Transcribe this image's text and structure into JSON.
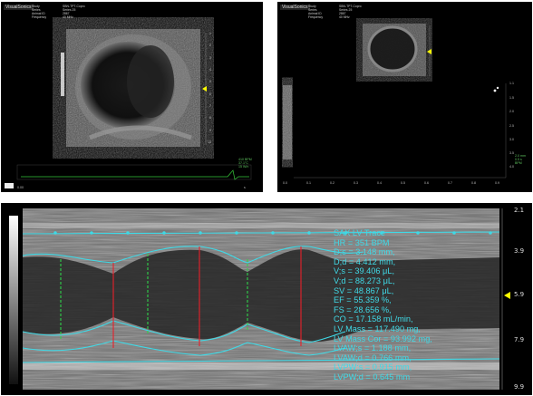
{
  "panel_a": {
    "logo": "VisualSonics",
    "info_labels": [
      "Study",
      "Series",
      "Animal ID",
      "Frequency"
    ],
    "info_values": [
      "SBN-TPT-Copro",
      "Series 25",
      "2867",
      "40 MHz"
    ],
    "depth_ticks": [
      "1",
      "2",
      "3",
      "4",
      "5",
      "6",
      "7",
      "8",
      "9",
      "10"
    ],
    "time_ticks": [
      "0.00",
      "s"
    ],
    "hud": [
      "410 BPM",
      "37.1°C",
      "15 W/n"
    ]
  },
  "panel_b": {
    "logo": "VisualSonics",
    "info_labels": [
      "Study",
      "Series",
      "Animal ID",
      "Frequency"
    ],
    "info_values": [
      "SBN-TPT-Copro",
      "Series 25",
      "2867",
      "40 MHz"
    ],
    "depth_ticks": [
      "1.1",
      "1.5",
      "2.0",
      "2.5",
      "3.0",
      "3.5",
      "4.0"
    ],
    "time_ticks": [
      "0.0",
      "0.1",
      "0.2",
      "0.3",
      "0.4",
      "0.5",
      "0.6",
      "0.7",
      "0.8",
      "0.9"
    ],
    "hud": [
      "2.0 mm",
      "0.5 s",
      "BPM"
    ]
  },
  "panel_c": {
    "depth_ticks": [
      "2.1",
      "3.9",
      "5.9",
      "7.9",
      "9.9"
    ],
    "measurements": [
      "SAX LV Trace",
      "HR = 351 BPM",
      "D;s = 3.148 mm,",
      "D;d = 4.412 mm,",
      "V;s = 39.406 μL,",
      "V;d = 88.273 μL,",
      "SV = 48.867 μL,",
      "EF = 55.359 %,",
      "FS = 28.656 %,",
      "CO = 17.158 mL/min,",
      "LV Mass = 117.490 mg,",
      "LV Mass Cor = 93.992 mg,",
      "LVAW;s = 1.188 mm,",
      "LVAW;d = 0.766 mm,",
      "LVPW;s = 0.915 mm,",
      "LVPW;d = 0.645 mm"
    ]
  },
  "colors": {
    "trace": "#3fd9e6",
    "diastole_marker": "#e8202a",
    "systole_marker": "#2fd34a",
    "depth_marker": "#ffff00"
  }
}
